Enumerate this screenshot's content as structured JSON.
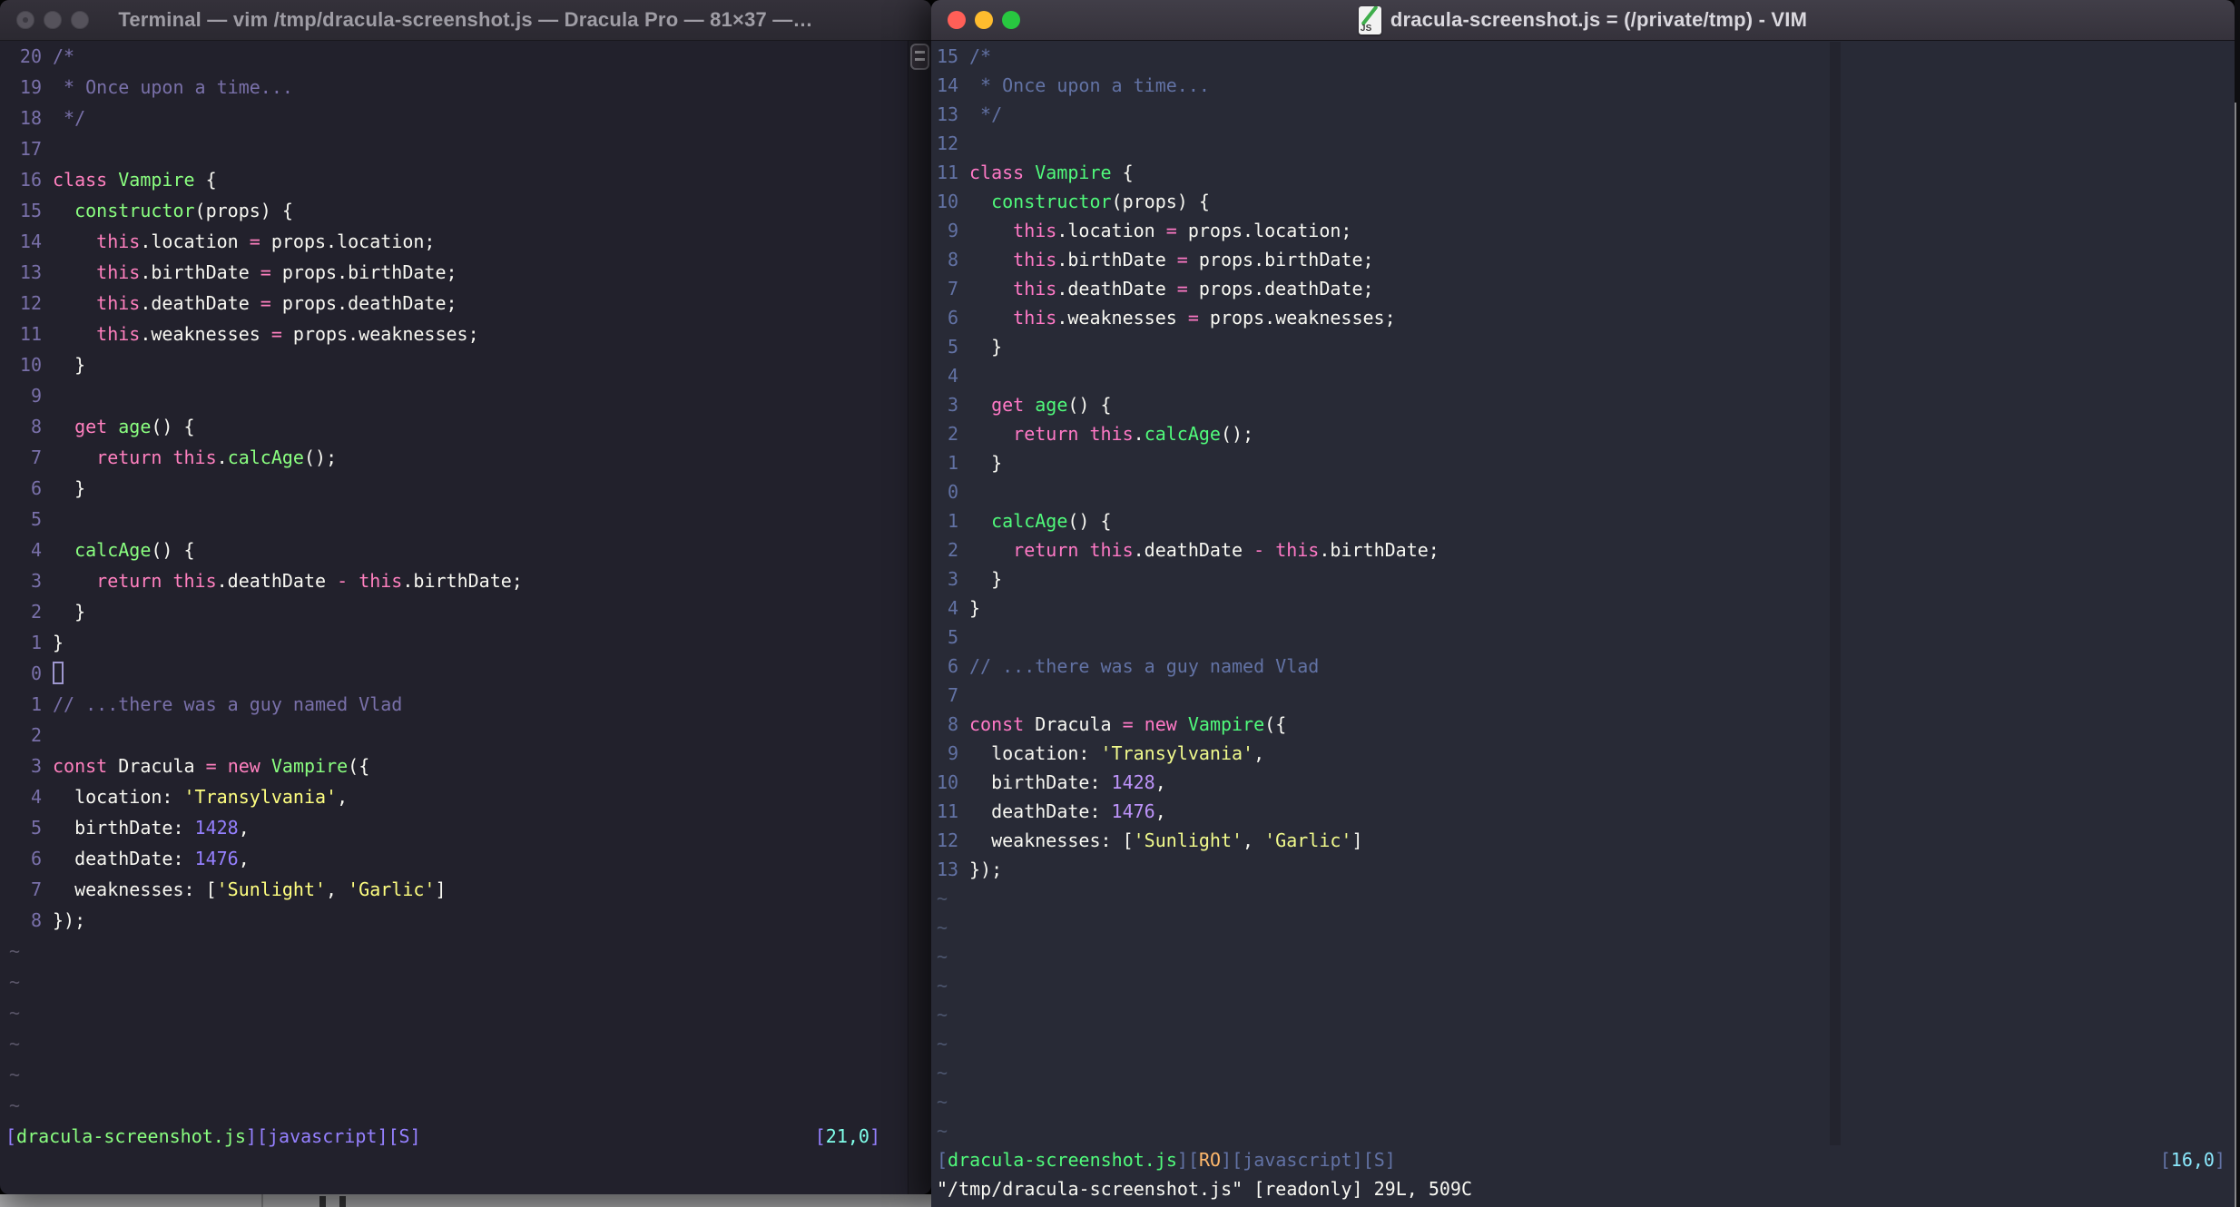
{
  "desktop": {
    "strip_color": "#bababc"
  },
  "buffer_lines": [
    [
      {
        "t": "/*",
        "c": "comment"
      }
    ],
    [
      {
        "t": " * Once upon a time...",
        "c": "comment"
      }
    ],
    [
      {
        "t": " */",
        "c": "comment"
      }
    ],
    [],
    [
      {
        "t": "class",
        "c": "keyword"
      },
      {
        "t": " ",
        "c": "fg"
      },
      {
        "t": "Vampire",
        "c": "func"
      },
      {
        "t": " {",
        "c": "fg"
      }
    ],
    [
      {
        "t": "  ",
        "c": "fg"
      },
      {
        "t": "constructor",
        "c": "func"
      },
      {
        "t": "(props) {",
        "c": "fg"
      }
    ],
    [
      {
        "t": "    ",
        "c": "fg"
      },
      {
        "t": "this",
        "c": "keyword"
      },
      {
        "t": ".location ",
        "c": "fg"
      },
      {
        "t": "=",
        "c": "keyword"
      },
      {
        "t": " props.location;",
        "c": "fg"
      }
    ],
    [
      {
        "t": "    ",
        "c": "fg"
      },
      {
        "t": "this",
        "c": "keyword"
      },
      {
        "t": ".birthDate ",
        "c": "fg"
      },
      {
        "t": "=",
        "c": "keyword"
      },
      {
        "t": " props.birthDate;",
        "c": "fg"
      }
    ],
    [
      {
        "t": "    ",
        "c": "fg"
      },
      {
        "t": "this",
        "c": "keyword"
      },
      {
        "t": ".deathDate ",
        "c": "fg"
      },
      {
        "t": "=",
        "c": "keyword"
      },
      {
        "t": " props.deathDate;",
        "c": "fg"
      }
    ],
    [
      {
        "t": "    ",
        "c": "fg"
      },
      {
        "t": "this",
        "c": "keyword"
      },
      {
        "t": ".weaknesses ",
        "c": "fg"
      },
      {
        "t": "=",
        "c": "keyword"
      },
      {
        "t": " props.weaknesses;",
        "c": "fg"
      }
    ],
    [
      {
        "t": "  }",
        "c": "fg"
      }
    ],
    [],
    [
      {
        "t": "  ",
        "c": "fg"
      },
      {
        "t": "get",
        "c": "keyword"
      },
      {
        "t": " ",
        "c": "fg"
      },
      {
        "t": "age",
        "c": "func"
      },
      {
        "t": "() {",
        "c": "fg"
      }
    ],
    [
      {
        "t": "    ",
        "c": "fg"
      },
      {
        "t": "return",
        "c": "keyword"
      },
      {
        "t": " ",
        "c": "fg"
      },
      {
        "t": "this",
        "c": "keyword"
      },
      {
        "t": ".",
        "c": "fg"
      },
      {
        "t": "calcAge",
        "c": "func"
      },
      {
        "t": "();",
        "c": "fg"
      }
    ],
    [
      {
        "t": "  }",
        "c": "fg"
      }
    ],
    [],
    [
      {
        "t": "  ",
        "c": "fg"
      },
      {
        "t": "calcAge",
        "c": "func"
      },
      {
        "t": "() {",
        "c": "fg"
      }
    ],
    [
      {
        "t": "    ",
        "c": "fg"
      },
      {
        "t": "return",
        "c": "keyword"
      },
      {
        "t": " ",
        "c": "fg"
      },
      {
        "t": "this",
        "c": "keyword"
      },
      {
        "t": ".deathDate ",
        "c": "fg"
      },
      {
        "t": "-",
        "c": "keyword"
      },
      {
        "t": " ",
        "c": "fg"
      },
      {
        "t": "this",
        "c": "keyword"
      },
      {
        "t": ".birthDate;",
        "c": "fg"
      }
    ],
    [
      {
        "t": "  }",
        "c": "fg"
      }
    ],
    [
      {
        "t": "}",
        "c": "fg"
      }
    ],
    [],
    [
      {
        "t": "// ...there was a guy named Vlad",
        "c": "comment"
      }
    ],
    [],
    [
      {
        "t": "const",
        "c": "keyword"
      },
      {
        "t": " Dracula ",
        "c": "fg"
      },
      {
        "t": "=",
        "c": "keyword"
      },
      {
        "t": " ",
        "c": "fg"
      },
      {
        "t": "new",
        "c": "keyword"
      },
      {
        "t": " ",
        "c": "fg"
      },
      {
        "t": "Vampire",
        "c": "func"
      },
      {
        "t": "({",
        "c": "fg"
      }
    ],
    [
      {
        "t": "  location: ",
        "c": "fg"
      },
      {
        "t": "'Transylvania'",
        "c": "string"
      },
      {
        "t": ",",
        "c": "fg"
      }
    ],
    [
      {
        "t": "  birthDate: ",
        "c": "fg"
      },
      {
        "t": "1428",
        "c": "number"
      },
      {
        "t": ",",
        "c": "fg"
      }
    ],
    [
      {
        "t": "  deathDate: ",
        "c": "fg"
      },
      {
        "t": "1476",
        "c": "number"
      },
      {
        "t": ",",
        "c": "fg"
      }
    ],
    [
      {
        "t": "  weaknesses: [",
        "c": "fg"
      },
      {
        "t": "'Sunlight'",
        "c": "string"
      },
      {
        "t": ", ",
        "c": "fg"
      },
      {
        "t": "'Garlic'",
        "c": "string"
      },
      {
        "t": "]",
        "c": "fg"
      }
    ],
    [
      {
        "t": "});",
        "c": "fg"
      }
    ]
  ],
  "tilde_char": "~",
  "left_window": {
    "title": "Terminal — vim /tmp/dracula-screenshot.js — Dracula Pro — 81×37 —…",
    "theme": {
      "bg": "#22212C",
      "fg": "#F8F8F2",
      "comment": "#7970A9",
      "keyword": "#FF80BF",
      "func": "#8AFF80",
      "string": "#FFFF80",
      "number": "#9580FF",
      "linenr": "#7970A9",
      "tilde": "#5a5669",
      "bracket": "#9580FF",
      "green": "#8AFF80",
      "cyan": "#80FFEA",
      "orange": "#FFCA80",
      "cursor": "#9e97cf"
    },
    "rel_numbers": [
      "20",
      "19",
      "18",
      "17",
      "16",
      "15",
      "14",
      "13",
      "12",
      "11",
      "10",
      "9",
      "8",
      "7",
      "6",
      "5",
      "4",
      "3",
      "2",
      "1",
      "0",
      "1",
      "2",
      "3",
      "4",
      "5",
      "6",
      "7",
      "8"
    ],
    "cursor": {
      "line_index": 20,
      "style": "hollow"
    },
    "tilde_count": 6,
    "statusline_left": [
      {
        "t": "[",
        "c": "bracket"
      },
      {
        "t": "dracula-screenshot.js",
        "c": "green"
      },
      {
        "t": "][",
        "c": "bracket"
      },
      {
        "t": "javascript",
        "c": "bracket"
      },
      {
        "t": "][",
        "c": "bracket"
      },
      {
        "t": "S",
        "c": "bracket"
      },
      {
        "t": "]",
        "c": "bracket"
      }
    ],
    "statusline_right": [
      {
        "t": "[",
        "c": "bracket"
      },
      {
        "t": "21,0",
        "c": "cyan"
      },
      {
        "t": "]",
        "c": "bracket"
      }
    ],
    "cmdline": ""
  },
  "right_window": {
    "title": "dracula-screenshot.js = (/private/tmp) - VIM",
    "icon_label": "JS",
    "traffic_lights": {
      "close": "#FF5F57",
      "minimize": "#FEBC2E",
      "zoom": "#28C840"
    },
    "theme": {
      "bg": "#282A36",
      "fg": "#F8F8F2",
      "comment": "#6272A4",
      "keyword": "#FF79C6",
      "func": "#50FA7B",
      "string": "#F1FA8C",
      "number": "#BD93F9",
      "linenr": "#6272A4",
      "tilde": "#4d566f",
      "bracket": "#6272A4",
      "green": "#50FA7B",
      "cyan": "#8BE9FD",
      "orange": "#FFB86C",
      "cursor": "#F8F8F2"
    },
    "rel_numbers": [
      "15",
      "14",
      "13",
      "12",
      "11",
      "10",
      "9",
      "8",
      "7",
      "6",
      "5",
      "4",
      "3",
      "2",
      "1",
      "0",
      "1",
      "2",
      "3",
      "4",
      "5",
      "6",
      "7",
      "8",
      "9",
      "10",
      "11",
      "12",
      "13"
    ],
    "cursor": {
      "line_index": 15,
      "style": "none"
    },
    "tilde_count": 9,
    "statusline_left": [
      {
        "t": "[",
        "c": "bracket"
      },
      {
        "t": "dracula-screenshot.js",
        "c": "green"
      },
      {
        "t": "][",
        "c": "bracket"
      },
      {
        "t": "RO",
        "c": "orange"
      },
      {
        "t": "][",
        "c": "bracket"
      },
      {
        "t": "javascript",
        "c": "bracket"
      },
      {
        "t": "][",
        "c": "bracket"
      },
      {
        "t": "S",
        "c": "bracket"
      },
      {
        "t": "]",
        "c": "bracket"
      }
    ],
    "statusline_right": [
      {
        "t": "[",
        "c": "bracket"
      },
      {
        "t": "16,0",
        "c": "cyan"
      },
      {
        "t": "]",
        "c": "bracket"
      }
    ],
    "cmdline": "\"/tmp/dracula-screenshot.js\" [readonly] 29L, 509C"
  }
}
